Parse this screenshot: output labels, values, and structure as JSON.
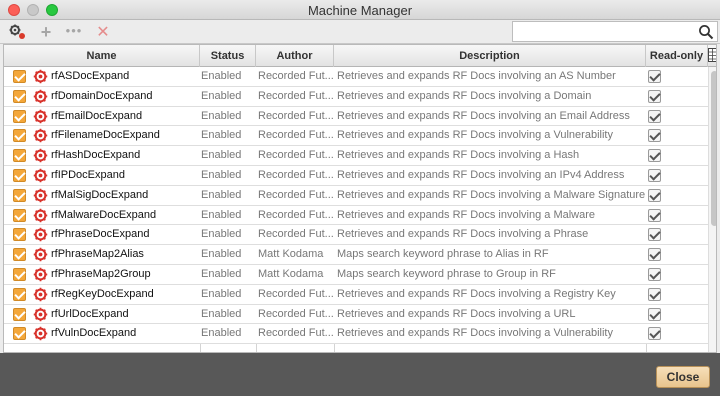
{
  "window": {
    "title": "Machine Manager"
  },
  "toolbar": {
    "icons": [
      "gear-link-icon",
      "add-icon",
      "more-icon",
      "delete-icon"
    ],
    "search": {
      "value": "",
      "placeholder": ""
    }
  },
  "table": {
    "columns": [
      "Name",
      "Status",
      "Author",
      "Description",
      "Read-only"
    ],
    "rows": [
      {
        "name": "rfASDocExpand",
        "status": "Enabled",
        "author": "Recorded Fut...",
        "description": "Retrieves and expands RF Docs involving an AS Number",
        "enabled": true,
        "read_only": true
      },
      {
        "name": "rfDomainDocExpand",
        "status": "Enabled",
        "author": "Recorded Fut...",
        "description": "Retrieves and expands RF Docs involving a Domain",
        "enabled": true,
        "read_only": true
      },
      {
        "name": "rfEmailDocExpand",
        "status": "Enabled",
        "author": "Recorded Fut...",
        "description": "Retrieves and expands RF Docs involving an Email Address",
        "enabled": true,
        "read_only": true
      },
      {
        "name": "rfFilenameDocExpand",
        "status": "Enabled",
        "author": "Recorded Fut...",
        "description": "Retrieves and expands RF Docs involving a Vulnerability",
        "enabled": true,
        "read_only": true
      },
      {
        "name": "rfHashDocExpand",
        "status": "Enabled",
        "author": "Recorded Fut...",
        "description": "Retrieves and expands RF Docs involving a Hash",
        "enabled": true,
        "read_only": true
      },
      {
        "name": "rfIPDocExpand",
        "status": "Enabled",
        "author": "Recorded Fut...",
        "description": "Retrieves and expands RF Docs involving an IPv4 Address",
        "enabled": true,
        "read_only": true
      },
      {
        "name": "rfMalSigDocExpand",
        "status": "Enabled",
        "author": "Recorded Fut...",
        "description": "Retrieves and expands RF Docs involving a Malware Signature",
        "enabled": true,
        "read_only": true
      },
      {
        "name": "rfMalwareDocExpand",
        "status": "Enabled",
        "author": "Recorded Fut...",
        "description": "Retrieves and expands RF Docs involving a Malware",
        "enabled": true,
        "read_only": true
      },
      {
        "name": "rfPhraseDocExpand",
        "status": "Enabled",
        "author": "Recorded Fut...",
        "description": "Retrieves and expands RF Docs involving a Phrase",
        "enabled": true,
        "read_only": true
      },
      {
        "name": "rfPhraseMap2Alias",
        "status": "Enabled",
        "author": "Matt Kodama",
        "description": "Maps search keyword phrase to Alias in RF",
        "enabled": true,
        "read_only": true
      },
      {
        "name": "rfPhraseMap2Group",
        "status": "Enabled",
        "author": "Matt Kodama",
        "description": "Maps search keyword phrase to Group in RF",
        "enabled": true,
        "read_only": true
      },
      {
        "name": "rfRegKeyDocExpand",
        "status": "Enabled",
        "author": "Recorded Fut...",
        "description": "Retrieves and expands RF Docs involving a Registry Key",
        "enabled": true,
        "read_only": true
      },
      {
        "name": "rfUrlDocExpand",
        "status": "Enabled",
        "author": "Recorded Fut...",
        "description": "Retrieves and expands RF Docs involving a URL",
        "enabled": true,
        "read_only": true
      },
      {
        "name": "rfVulnDocExpand",
        "status": "Enabled",
        "author": "Recorded Fut...",
        "description": "Retrieves and expands RF Docs involving a Vulnerability",
        "enabled": true,
        "read_only": true
      }
    ]
  },
  "footer": {
    "close_label": "Close"
  },
  "colors": {
    "accent_checkbox": "#f4a73a",
    "footer_bg": "#585858",
    "close_button": "#efd3a4"
  }
}
